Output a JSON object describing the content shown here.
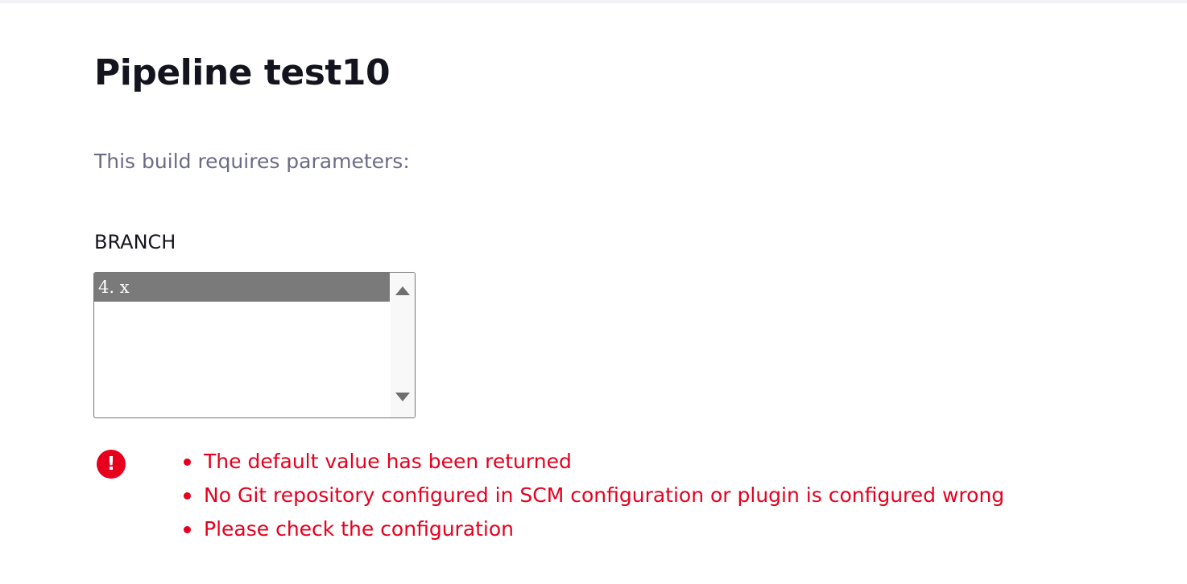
{
  "page": {
    "title": "Pipeline test10",
    "description": "This build requires parameters:"
  },
  "parameter": {
    "name": "BRANCH",
    "options": [
      "4. x"
    ],
    "selected": "4. x"
  },
  "errors": {
    "icon": "exclamation-icon",
    "icon_glyph": "!",
    "messages": [
      "The default value has been returned",
      "No Git repository configured in SCM configuration or plugin is configured wrong",
      "Please check the configuration"
    ]
  },
  "colors": {
    "title": "#14141f",
    "description": "#6b6b87",
    "error": "#e6001e",
    "selected_option_bg": "#7a7a7a"
  }
}
